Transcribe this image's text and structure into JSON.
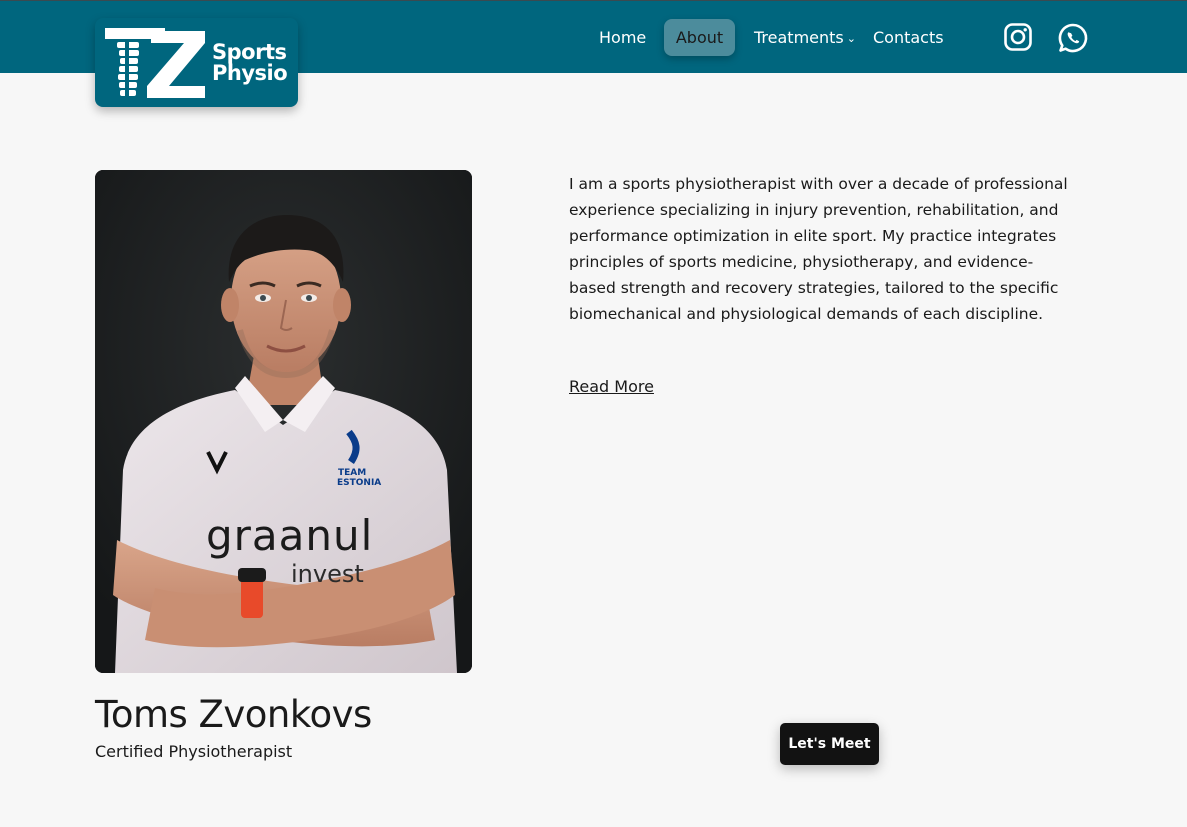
{
  "brand": {
    "logo_letters": "TZ",
    "logo_line1": "Sports",
    "logo_line2": "Physio",
    "color": "#00667e"
  },
  "nav": {
    "items": [
      {
        "label": "Home",
        "active": false
      },
      {
        "label": "About",
        "active": true
      },
      {
        "label": "Treatments",
        "has_dropdown": true
      },
      {
        "label": "Contacts",
        "active": false
      }
    ],
    "social": [
      "instagram-icon",
      "whatsapp-icon"
    ]
  },
  "profile": {
    "name": "Toms Zvonkovs",
    "title": "Certified Physiotherapist",
    "bio": "I am a sports physiotherapist with over a decade of professional experience specializing in injury prevention, rehabilitation, and performance optimization in elite sport. My practice integrates principles of sports medicine, physiotherapy, and evidence-based strength and recovery strategies, tailored to the specific biomechanical and physiological demands of each discipline.",
    "read_more": "Read More",
    "shirt_text_main": "graanul",
    "shirt_text_sub": "invest",
    "shirt_badge_line1": "TEAM",
    "shirt_badge_line2": "ESTONIA"
  },
  "cta": {
    "label": "Let's Meet"
  }
}
